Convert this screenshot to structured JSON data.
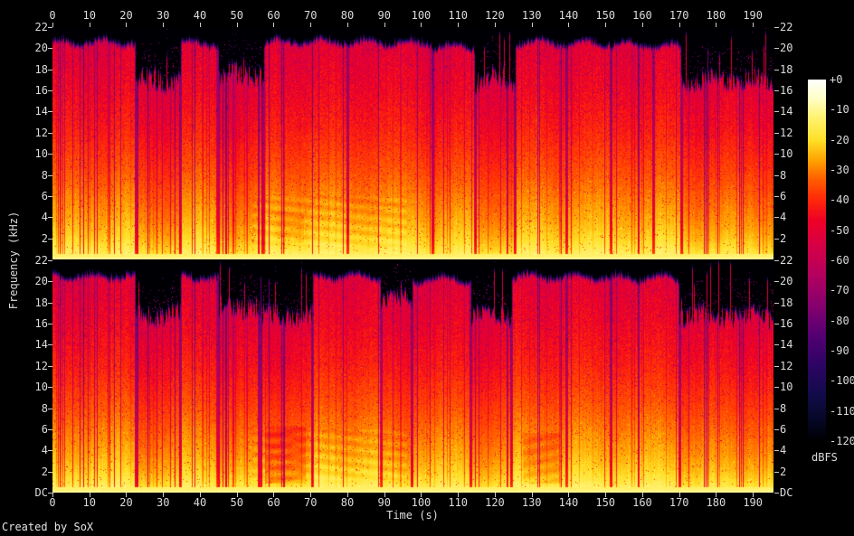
{
  "footer": {
    "credit": "Created by SoX"
  },
  "axes": {
    "time": {
      "label": "Time (s)",
      "tick_labels": [
        "0",
        "10",
        "20",
        "30",
        "40",
        "50",
        "60",
        "70",
        "80",
        "90",
        "100",
        "110",
        "120",
        "130",
        "140",
        "150",
        "160",
        "170",
        "180",
        "190"
      ]
    },
    "freq": {
      "label": "Frequency (kHz)",
      "tick_labels_channel1": [
        "22",
        "20",
        "18",
        "16",
        "14",
        "12",
        "10",
        "8",
        "6",
        "4",
        "2"
      ],
      "tick_labels_channel2": [
        "22",
        "20",
        "18",
        "16",
        "14",
        "12",
        "10",
        "8",
        "6",
        "4",
        "2",
        "DC"
      ]
    },
    "colorbar": {
      "label": "dBFS",
      "tick_labels": [
        "+0",
        "-10",
        "-20",
        "-30",
        "-40",
        "-50",
        "-60",
        "-70",
        "-80",
        "-90",
        "-100",
        "-110",
        "-120"
      ]
    }
  },
  "chart_data": {
    "type": "heatmap",
    "subtype": "audio-spectrogram",
    "tool": "SoX",
    "title": "",
    "x_axis": {
      "label": "Time (s)",
      "unit": "s",
      "range": [
        0,
        195.6
      ],
      "tick_step": 10
    },
    "y_axis": {
      "label": "Frequency (kHz)",
      "unit": "kHz",
      "range": [
        0,
        22
      ],
      "tick_step": 2,
      "dc_label": "DC"
    },
    "z_axis": {
      "label": "dBFS",
      "range": [
        0,
        -120
      ],
      "tick_step": -10
    },
    "grid": false,
    "legend_position": "right-colorbar",
    "palette": [
      [
        0,
        [
          255,
          255,
          255
        ]
      ],
      [
        -6,
        [
          255,
          255,
          200
        ]
      ],
      [
        -12,
        [
          255,
          244,
          120
        ]
      ],
      [
        -20,
        [
          255,
          225,
          40
        ]
      ],
      [
        -27,
        [
          255,
          160,
          0
        ]
      ],
      [
        -33,
        [
          255,
          95,
          0
        ]
      ],
      [
        -40,
        [
          255,
          40,
          10
        ]
      ],
      [
        -47,
        [
          238,
          0,
          40
        ]
      ],
      [
        -55,
        [
          215,
          0,
          70
        ]
      ],
      [
        -65,
        [
          180,
          0,
          95
        ]
      ],
      [
        -75,
        [
          135,
          0,
          110
        ]
      ],
      [
        -85,
        [
          85,
          0,
          115
        ]
      ],
      [
        -95,
        [
          45,
          5,
          100
        ]
      ],
      [
        -105,
        [
          18,
          12,
          73
        ]
      ],
      [
        -113,
        [
          6,
          8,
          40
        ]
      ],
      [
        -120,
        [
          0,
          0,
          4
        ]
      ]
    ],
    "level_profile_db_by_khz": [
      [
        0,
        -8
      ],
      [
        0.5,
        -14
      ],
      [
        1,
        -17
      ],
      [
        2,
        -21
      ],
      [
        3.5,
        -25
      ],
      [
        5,
        -28
      ],
      [
        8,
        -34
      ],
      [
        12,
        -41
      ],
      [
        16,
        -46
      ],
      [
        20,
        -50
      ],
      [
        22,
        -52
      ]
    ],
    "channels": [
      {
        "name": "channel-1-top",
        "sections": [
          {
            "t0": 0,
            "t1": 22.5,
            "hf_cutoff_khz": 20.3,
            "gain_db": 0
          },
          {
            "t0": 22.5,
            "t1": 34.7,
            "hf_cutoff_khz": 16.3,
            "gain_db": -4
          },
          {
            "t0": 34.7,
            "t1": 45.0,
            "hf_cutoff_khz": 20.2,
            "gain_db": 0
          },
          {
            "t0": 45.0,
            "t1": 57.2,
            "hf_cutoff_khz": 16.9,
            "gain_db": -4
          },
          {
            "t0": 57.2,
            "t1": 80.0,
            "hf_cutoff_khz": 20.35,
            "gain_db": 0
          },
          {
            "t0": 80.0,
            "t1": 103.0,
            "hf_cutoff_khz": 20.25,
            "gain_db": 0
          },
          {
            "t0": 103.0,
            "t1": 114.5,
            "hf_cutoff_khz": 19.9,
            "gain_db": -1
          },
          {
            "t0": 114.5,
            "t1": 125.5,
            "hf_cutoff_khz": 16.5,
            "gain_db": -4
          },
          {
            "t0": 125.5,
            "t1": 139.5,
            "hf_cutoff_khz": 20.3,
            "gain_db": 0
          },
          {
            "t0": 139.5,
            "t1": 151.5,
            "hf_cutoff_khz": 20.2,
            "gain_db": 0
          },
          {
            "t0": 151.5,
            "t1": 163.0,
            "hf_cutoff_khz": 20.1,
            "gain_db": 0
          },
          {
            "t0": 163.0,
            "t1": 170.5,
            "hf_cutoff_khz": 19.9,
            "gain_db": 0
          },
          {
            "t0": 170.5,
            "t1": 195.6,
            "hf_cutoff_khz": 16.4,
            "gain_db": -3
          }
        ]
      },
      {
        "name": "channel-2-bottom",
        "sections": [
          {
            "t0": 0,
            "t1": 22.5,
            "hf_cutoff_khz": 20.2,
            "gain_db": 0
          },
          {
            "t0": 22.5,
            "t1": 34.7,
            "hf_cutoff_khz": 16.4,
            "gain_db": -4
          },
          {
            "t0": 34.7,
            "t1": 45.0,
            "hf_cutoff_khz": 20.1,
            "gain_db": 0
          },
          {
            "t0": 45.0,
            "t1": 56.5,
            "hf_cutoff_khz": 17.0,
            "gain_db": -4
          },
          {
            "t0": 56.5,
            "t1": 70.5,
            "hf_cutoff_khz": 16.2,
            "gain_db": -4
          },
          {
            "t0": 70.5,
            "t1": 89.0,
            "hf_cutoff_khz": 20.2,
            "gain_db": 0
          },
          {
            "t0": 89.0,
            "t1": 97.5,
            "hf_cutoff_khz": 17.6,
            "gain_db": -3
          },
          {
            "t0": 97.5,
            "t1": 113.5,
            "hf_cutoff_khz": 19.9,
            "gain_db": -1
          },
          {
            "t0": 113.5,
            "t1": 124.5,
            "hf_cutoff_khz": 16.3,
            "gain_db": -4
          },
          {
            "t0": 124.5,
            "t1": 139.5,
            "hf_cutoff_khz": 20.2,
            "gain_db": 0
          },
          {
            "t0": 139.5,
            "t1": 151.5,
            "hf_cutoff_khz": 20.1,
            "gain_db": 0
          },
          {
            "t0": 151.5,
            "t1": 170.0,
            "hf_cutoff_khz": 20.05,
            "gain_db": 0
          },
          {
            "t0": 170.0,
            "t1": 195.6,
            "hf_cutoff_khz": 16.2,
            "gain_db": -3
          }
        ]
      }
    ],
    "lowmid_quiet_patches": [
      {
        "channel": 1,
        "t0": 57.6,
        "t1": 68.5,
        "f0": 0.8,
        "f1": 6.2,
        "depth_db": 7
      },
      {
        "channel": 1,
        "t0": 127.5,
        "t1": 137.5,
        "f0": 0.8,
        "f1": 5.6,
        "depth_db": 6
      },
      {
        "channel": 0,
        "t0": 60.0,
        "t1": 68.0,
        "f0": 1.5,
        "f1": 4.5,
        "depth_db": 3
      }
    ],
    "harmonic_texture": {
      "t0": 54,
      "t1": 96,
      "f0": 1.2,
      "f1": 6.0,
      "amp_db": 2.0
    }
  }
}
